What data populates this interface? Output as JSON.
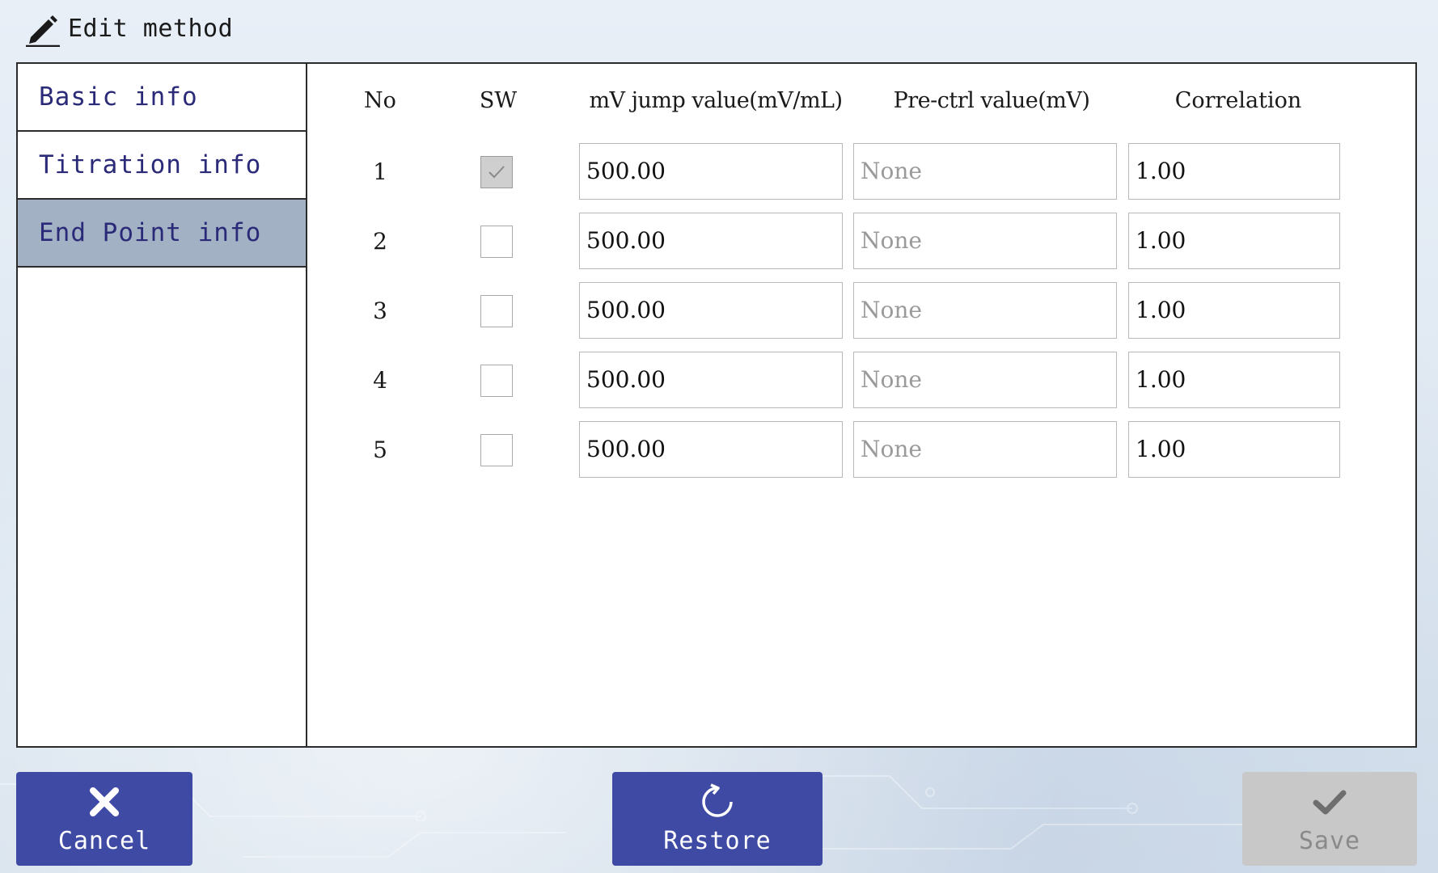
{
  "header": {
    "title": "Edit method",
    "icon": "pencil-icon"
  },
  "sidebar": {
    "items": [
      {
        "label": "Basic info",
        "active": false
      },
      {
        "label": "Titration info",
        "active": false
      },
      {
        "label": "End Point info",
        "active": true
      }
    ]
  },
  "table": {
    "columns": {
      "no": "No",
      "sw": "SW",
      "mv_jump": "mV jump value(mV/mL)",
      "pre_ctrl": "Pre-ctrl value(mV)",
      "correlation": "Correlation"
    },
    "rows": [
      {
        "no": "1",
        "sw": true,
        "mv_jump": "500.00",
        "pre_ctrl": "None",
        "correlation": "1.00"
      },
      {
        "no": "2",
        "sw": false,
        "mv_jump": "500.00",
        "pre_ctrl": "None",
        "correlation": "1.00"
      },
      {
        "no": "3",
        "sw": false,
        "mv_jump": "500.00",
        "pre_ctrl": "None",
        "correlation": "1.00"
      },
      {
        "no": "4",
        "sw": false,
        "mv_jump": "500.00",
        "pre_ctrl": "None",
        "correlation": "1.00"
      },
      {
        "no": "5",
        "sw": false,
        "mv_jump": "500.00",
        "pre_ctrl": "None",
        "correlation": "1.00"
      }
    ]
  },
  "footer": {
    "cancel_label": "Cancel",
    "restore_label": "Restore",
    "save_label": "Save",
    "cancel_icon": "close-icon",
    "restore_icon": "refresh-icon",
    "save_icon": "checkmark-icon"
  },
  "colors": {
    "primary_button": "#3e4aa4",
    "disabled_button": "#c8c8c8",
    "active_tab": "#a3b1c4",
    "tab_text": "#2a2a78"
  }
}
